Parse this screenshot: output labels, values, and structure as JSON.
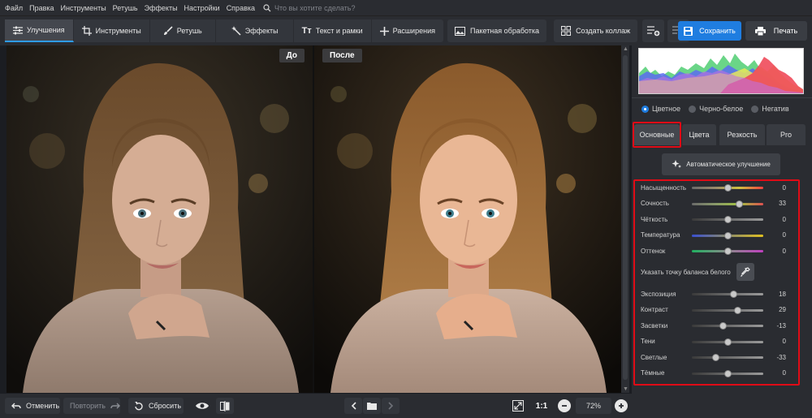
{
  "menu": [
    "Файл",
    "Правка",
    "Инструменты",
    "Ретушь",
    "Эффекты",
    "Настройки",
    "Справка"
  ],
  "search": {
    "placeholder": "Что вы хотите сделать?"
  },
  "toolbar": {
    "tabs": [
      {
        "label": "Улучшения",
        "icon": "sliders-icon",
        "active": true
      },
      {
        "label": "Инструменты",
        "icon": "crop-icon"
      },
      {
        "label": "Ретушь",
        "icon": "brush-icon"
      },
      {
        "label": "Эффекты",
        "icon": "sparkle-icon"
      },
      {
        "label": "Текст и рамки",
        "icon": "text-icon"
      },
      {
        "label": "Расширения",
        "icon": "plus-icon"
      }
    ],
    "batch_label": "Пакетная обработка",
    "collage_label": "Создать коллаж",
    "save_label": "Сохранить",
    "print_label": "Печать"
  },
  "canvas": {
    "before_label": "До",
    "after_label": "После"
  },
  "bottom": {
    "undo_label": "Отменить",
    "redo_label": "Повторить",
    "reset_label": "Сбросить",
    "one_to_one": "1:1",
    "zoom": "72%"
  },
  "panel": {
    "modes": [
      {
        "label": "Цветное",
        "selected": true
      },
      {
        "label": "Черно-белое",
        "selected": false
      },
      {
        "label": "Негатив",
        "selected": false
      }
    ],
    "tabs": [
      {
        "label": "Основные",
        "active": true
      },
      {
        "label": "Цвета",
        "active": false
      },
      {
        "label": "Резкость",
        "active": false
      },
      {
        "label": "Pro",
        "active": false
      }
    ],
    "auto_label": "Автоматическое улучшение",
    "white_balance_label": "Указать точку баланса белого",
    "sliders_top": [
      {
        "label": "Насыщенность",
        "value": 0,
        "min": -100,
        "max": 100,
        "track": "saturation"
      },
      {
        "label": "Сочность",
        "value": 33,
        "min": -100,
        "max": 100,
        "track": "vibrance"
      },
      {
        "label": "Чёткость",
        "value": 0,
        "min": -100,
        "max": 100,
        "track": "gray"
      },
      {
        "label": "Температура",
        "value": 0,
        "min": -100,
        "max": 100,
        "track": "temperature"
      },
      {
        "label": "Оттенок",
        "value": 0,
        "min": -100,
        "max": 100,
        "track": "tint"
      }
    ],
    "sliders_bottom": [
      {
        "label": "Экспозиция",
        "value": 18,
        "min": -100,
        "max": 100,
        "track": "gray"
      },
      {
        "label": "Контраст",
        "value": 29,
        "min": -100,
        "max": 100,
        "track": "gray"
      },
      {
        "label": "Засветки",
        "value": -13,
        "min": -100,
        "max": 100,
        "track": "gray"
      },
      {
        "label": "Тени",
        "value": 0,
        "min": -100,
        "max": 100,
        "track": "gray"
      },
      {
        "label": "Светлые",
        "value": -33,
        "min": -100,
        "max": 100,
        "track": "gray"
      },
      {
        "label": "Тёмные",
        "value": 0,
        "min": -100,
        "max": 100,
        "track": "gray"
      }
    ]
  },
  "colors": {
    "accent": "#1f7de0",
    "highlight": "#e00b16",
    "active_tab_underline": "#2f9cf0"
  }
}
